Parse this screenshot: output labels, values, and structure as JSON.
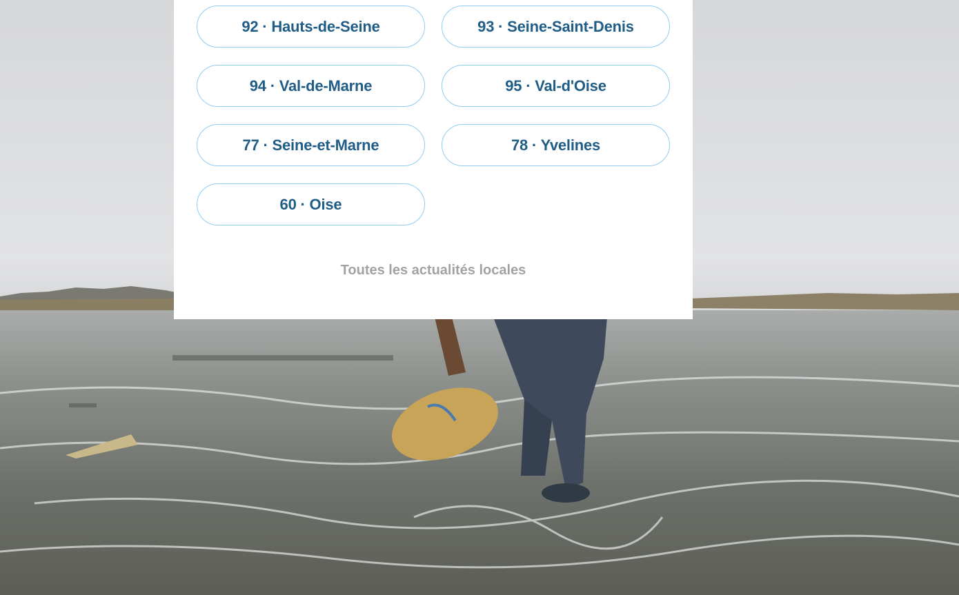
{
  "departments": [
    {
      "label": "92 · Hauts-de-Seine"
    },
    {
      "label": "93 · Seine-Saint-Denis"
    },
    {
      "label": "94 · Val-de-Marne"
    },
    {
      "label": "95 · Val-d'Oise"
    },
    {
      "label": "77 · Seine-et-Marne"
    },
    {
      "label": "78 · Yvelines"
    },
    {
      "label": "60 · Oise"
    }
  ],
  "all_link": "Toutes les actualités locales",
  "colors": {
    "button_border": "#8ecdf2",
    "button_text": "#1f5c86",
    "link_text": "#a0a3a6",
    "panel_bg": "#ffffff"
  }
}
